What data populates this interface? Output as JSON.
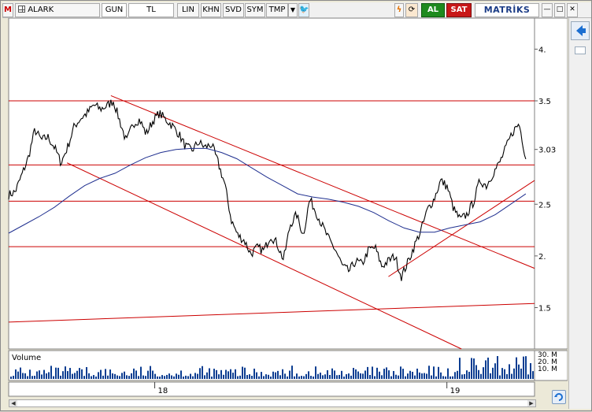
{
  "toolbar": {
    "logo": "M",
    "symbol_menu": "ALARK",
    "period": "GUN",
    "currency": "TL",
    "scale": "LIN",
    "khn": "KHN",
    "svd": "SVD",
    "sym": "SYM",
    "tmp": "TMP",
    "buy": "AL",
    "sell": "SAT",
    "brand": "MATRİKS",
    "win_min": "—",
    "win_max": "□",
    "win_close": "✕"
  },
  "colors": {
    "price": "#000000",
    "moving_average": "#1f2f8f",
    "trendline": "#cc0000",
    "volume": "#0b3d91",
    "accent": "#1b6fd1"
  },
  "chart_data": {
    "type": "line",
    "symbol": "ALARK",
    "series": [
      {
        "values": [
          2.59,
          2.62,
          2.78,
          2.95,
          3.22,
          3.12,
          3.15,
          3.05,
          2.9,
          3.05,
          3.25,
          3.33,
          3.38,
          3.46,
          3.42,
          3.45,
          3.5,
          3.3,
          3.1,
          3.28,
          3.32,
          3.18,
          3.3,
          3.38,
          3.32,
          3.26,
          3.18,
          3.06,
          3.02,
          3.1,
          3.05,
          3.08,
          2.9,
          2.7,
          2.35,
          2.2,
          2.15,
          2.02,
          2.08,
          2.05,
          2.2,
          2.12,
          1.96,
          2.3,
          2.4,
          2.2,
          2.55,
          2.42,
          2.28,
          2.15,
          2.05,
          1.9,
          1.85,
          1.95,
          1.92,
          2.06,
          2.08,
          1.9,
          1.95,
          2.0,
          1.8,
          1.94,
          2.1,
          2.25,
          2.45,
          2.55,
          2.73,
          2.67,
          2.45,
          2.35,
          2.4,
          2.52,
          2.73,
          2.68,
          2.8,
          2.9,
          3.05,
          3.2,
          3.28,
          2.95
        ]
      },
      {
        "values": [
          2.22,
          2.3,
          2.38,
          2.47,
          2.58,
          2.68,
          2.75,
          2.8,
          2.88,
          2.95,
          3.0,
          3.03,
          3.04,
          3.04,
          3.0,
          2.94,
          2.85,
          2.76,
          2.68,
          2.6,
          2.57,
          2.55,
          2.52,
          2.48,
          2.42,
          2.34,
          2.27,
          2.23,
          2.23,
          2.27,
          2.3,
          2.33,
          2.4,
          2.5,
          2.6
        ]
      }
    ],
    "y_ticks": [
      "4.",
      "3.5",
      "3.03",
      "2.5",
      "2.",
      "1.5"
    ],
    "ylim": [
      1.1,
      4.3
    ],
    "x_ticks": [
      "18",
      "19"
    ],
    "horizontal_lines": [
      3.5,
      2.88,
      2.53,
      2.09
    ],
    "trendlines": [
      {
        "from": [
          0.2,
          2.9
        ],
        "to": [
          1.55,
          1.1
        ]
      },
      {
        "from": [
          0.35,
          3.55
        ],
        "to": [
          1.8,
          1.88
        ]
      },
      {
        "from": [
          0.0,
          1.36
        ],
        "to": [
          1.8,
          1.54
        ]
      },
      {
        "from": [
          1.3,
          1.8
        ],
        "to": [
          1.8,
          2.73
        ]
      }
    ],
    "volume_label": "Volume",
    "volume_ticks": [
      "30. M",
      "20. M",
      "10. M"
    ],
    "volume_max": 32
  }
}
